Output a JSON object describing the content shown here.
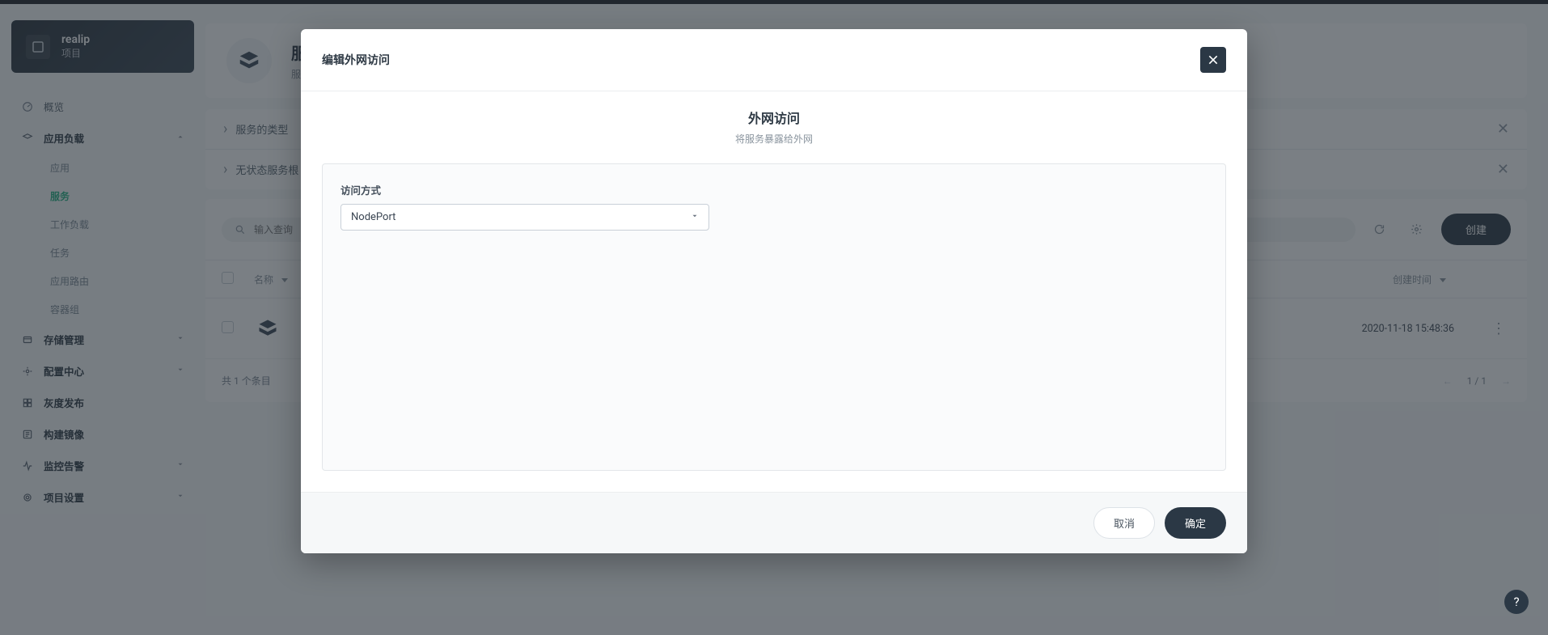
{
  "project": {
    "name": "realip",
    "type": "项目"
  },
  "sidebar": {
    "overview": "概览",
    "groups": [
      {
        "label": "应用负载",
        "open": true,
        "items": [
          "应用",
          "服务",
          "工作负载",
          "任务",
          "应用路由",
          "容器组"
        ],
        "activeIndex": 1
      },
      {
        "label": "存储管理",
        "open": false,
        "items": []
      },
      {
        "label": "配置中心",
        "open": false,
        "items": []
      },
      {
        "label": "灰度发布",
        "open": false,
        "items": []
      },
      {
        "label": "构建镜像",
        "open": false,
        "items": []
      },
      {
        "label": "监控告警",
        "open": false,
        "items": []
      },
      {
        "label": "项目设置",
        "open": false,
        "items": []
      }
    ]
  },
  "page_header": {
    "title": "服",
    "sub": "服务"
  },
  "info_rows": [
    "服务的类型",
    "无状态服务根"
  ],
  "search": {
    "placeholder": "输入查询"
  },
  "toolbar": {
    "create": "创建"
  },
  "table": {
    "columns": {
      "name": "名称",
      "created": "创建时间"
    },
    "rows": [
      {
        "created": "2020-11-18 15:48:36"
      }
    ],
    "footer": "共 1 个条目",
    "pager": "1 / 1"
  },
  "modal": {
    "title": "编辑外网访问",
    "intro_title": "外网访问",
    "intro_sub": "将服务暴露给外网",
    "field_label": "访问方式",
    "select_value": "NodePort",
    "cancel": "取消",
    "ok": "确定"
  },
  "help": "?"
}
